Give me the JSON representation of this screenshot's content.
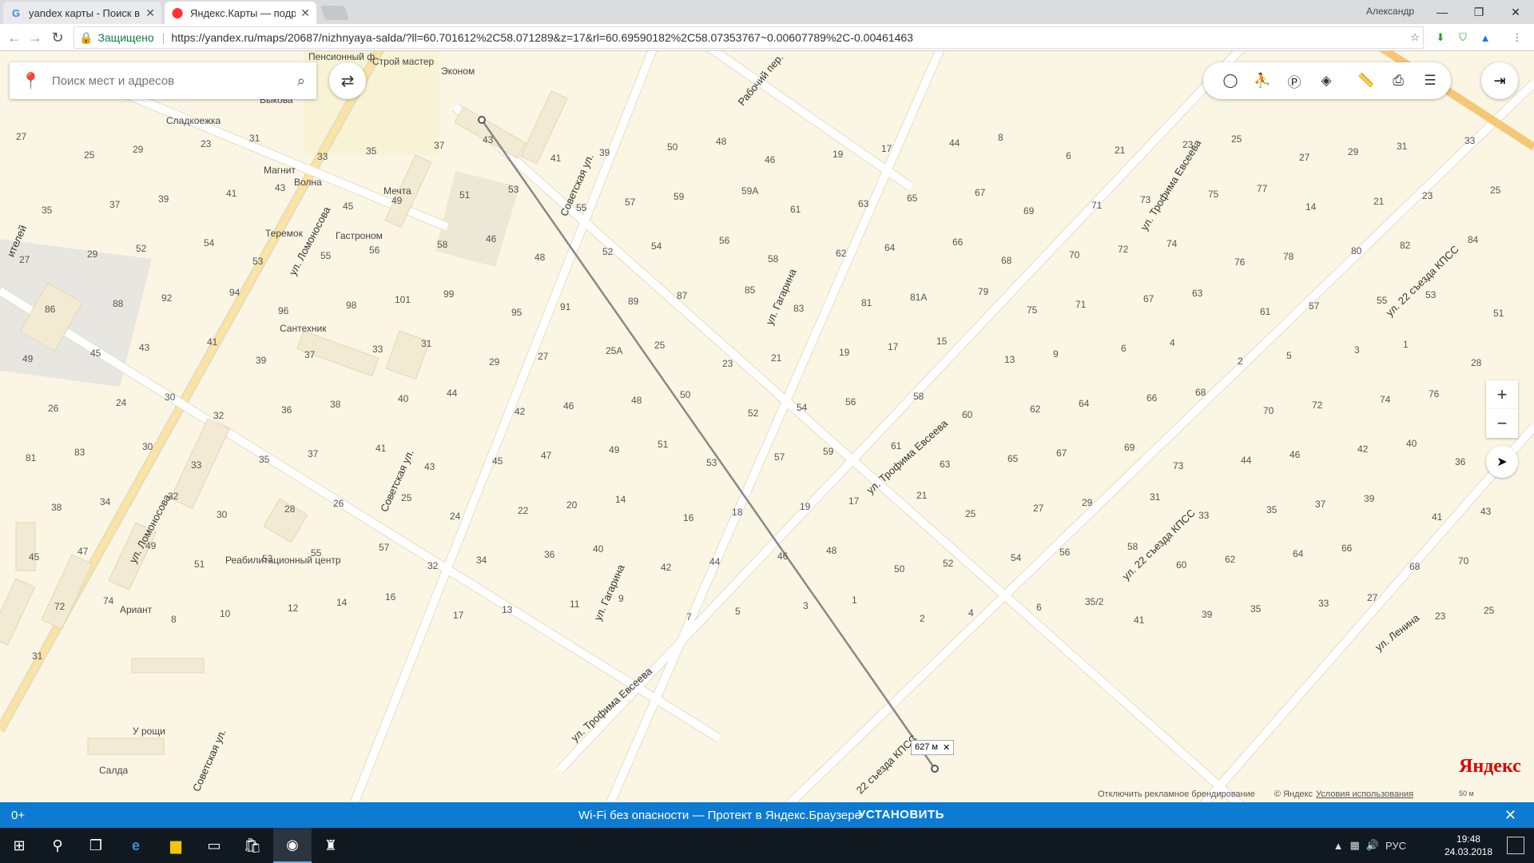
{
  "browser": {
    "tabs": [
      {
        "title": "yandex карты - Поиск в",
        "favicon": "G"
      },
      {
        "title": "Яндекс.Карты — подроб",
        "favicon": "pin"
      }
    ],
    "user": "Александр",
    "security_label": "Защищено",
    "url": "https://yandex.ru/maps/20687/nizhnyaya-salda/?ll=60.701612%2C58.071289&z=17&rl=60.69590182%2C58.07353767~0.00607789%2C-0.00461463"
  },
  "search": {
    "placeholder": "Поиск мест и адресов"
  },
  "map": {
    "streets": [
      {
        "name": "ул. Ломоносова"
      },
      {
        "name": "ул. Ломоносова"
      },
      {
        "name": "Советская ул."
      },
      {
        "name": "Советская ул."
      },
      {
        "name": "Советская ул."
      },
      {
        "name": "ул. Гагарина"
      },
      {
        "name": "ул. Гагарина"
      },
      {
        "name": "ул. Трофима Евсеева"
      },
      {
        "name": "ул. Трофима Евсеева"
      },
      {
        "name": "ул. Трофима Евсеева"
      },
      {
        "name": "ул. 22 съезда КПСС"
      },
      {
        "name": "ул. 22 съезда КПСС"
      },
      {
        "name": "22 съезда КПСС"
      },
      {
        "name": "Рабочий пер."
      },
      {
        "name": "ул. Ленина"
      },
      {
        "name": "ителей"
      }
    ],
    "pois": [
      {
        "name": "Пенсионный ф"
      },
      {
        "name": "Строй мастер"
      },
      {
        "name": "Эконом"
      },
      {
        "name": "Сладкоежка"
      },
      {
        "name": "Выкова"
      },
      {
        "name": "Магнит"
      },
      {
        "name": "Волна"
      },
      {
        "name": "Мечта"
      },
      {
        "name": "Теремок"
      },
      {
        "name": "Гастроном"
      },
      {
        "name": "Сантехник"
      },
      {
        "name": "Реабилитационный центр"
      },
      {
        "name": "Ариант"
      },
      {
        "name": "У рощи"
      },
      {
        "name": "Салда"
      }
    ],
    "house_numbers": [
      "27",
      "25",
      "29",
      "23",
      "31",
      "33",
      "35",
      "37",
      "43",
      "41",
      "39",
      "50",
      "48",
      "46",
      "19",
      "17",
      "44",
      "8",
      "6",
      "21",
      "23",
      "25",
      "27",
      "29",
      "31",
      "33",
      "35",
      "37",
      "39",
      "41",
      "43",
      "45",
      "49",
      "51",
      "53",
      "55",
      "57",
      "59",
      "59А",
      "61",
      "63",
      "65",
      "67",
      "69",
      "71",
      "73",
      "75",
      "77",
      "14",
      "21",
      "23",
      "25",
      "27",
      "29",
      "52",
      "54",
      "53",
      "55",
      "56",
      "58",
      "46",
      "48",
      "52",
      "54",
      "56",
      "58",
      "62",
      "64",
      "66",
      "68",
      "70",
      "72",
      "74",
      "76",
      "78",
      "80",
      "82",
      "84",
      "86",
      "88",
      "92",
      "94",
      "96",
      "98",
      "101",
      "99",
      "95",
      "91",
      "89",
      "87",
      "85",
      "83",
      "81",
      "81А",
      "79",
      "75",
      "71",
      "67",
      "63",
      "61",
      "57",
      "55",
      "53",
      "51",
      "49",
      "45",
      "43",
      "41",
      "39",
      "37",
      "33",
      "31",
      "29",
      "27",
      "25А",
      "25",
      "23",
      "21",
      "19",
      "17",
      "15",
      "13",
      "9",
      "6",
      "4",
      "2",
      "5",
      "3",
      "1",
      "28",
      "26",
      "24",
      "30",
      "32",
      "36",
      "38",
      "40",
      "44",
      "42",
      "46",
      "48",
      "50",
      "52",
      "54",
      "56",
      "58",
      "60",
      "62",
      "64",
      "66",
      "68",
      "70",
      "72",
      "74",
      "76",
      "78",
      "81",
      "83",
      "30",
      "33",
      "35",
      "37",
      "41",
      "43",
      "45",
      "47",
      "49",
      "51",
      "53",
      "57",
      "59",
      "61",
      "63",
      "65",
      "67",
      "69",
      "73",
      "44",
      "46",
      "42",
      "40",
      "36",
      "38",
      "34",
      "32",
      "30",
      "28",
      "26",
      "25",
      "24",
      "22",
      "20",
      "14",
      "16",
      "18",
      "19",
      "17",
      "21",
      "25",
      "27",
      "29",
      "31",
      "33",
      "35",
      "37",
      "39",
      "41",
      "43",
      "45",
      "47",
      "49",
      "51",
      "53",
      "55",
      "57",
      "32",
      "34",
      "36",
      "40",
      "42",
      "44",
      "46",
      "48",
      "50",
      "52",
      "54",
      "56",
      "58",
      "60",
      "62",
      "64",
      "66",
      "68",
      "70",
      "72",
      "74",
      "8",
      "10",
      "12",
      "14",
      "16",
      "17",
      "13",
      "11",
      "9",
      "7",
      "5",
      "3",
      "1",
      "2",
      "4",
      "6",
      "35/2",
      "41",
      "39",
      "35",
      "33",
      "27",
      "23",
      "25",
      "31"
    ],
    "ruler": {
      "distance": "627 м"
    },
    "logo": "Яндекс",
    "footer": {
      "disable_branding": "Отключить рекламное брендирование",
      "copyright": "© Яндекс",
      "terms": "Условия использования"
    },
    "scale": "50 м"
  },
  "banner": {
    "age": "0+",
    "message": "Wi-Fi без опасности — Протект в Яндекс.Браузере",
    "install": "УСТАНОВИТЬ"
  },
  "taskbar": {
    "lang": "РУС",
    "time": "19:48",
    "date": "24.03.2018"
  }
}
